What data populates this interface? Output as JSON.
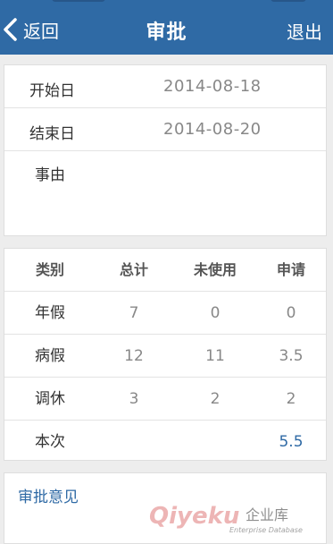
{
  "nav": {
    "back_label": "返回",
    "title": "审批",
    "exit_label": "退出"
  },
  "request": {
    "start_label": "开始日",
    "start_value": "2014-08-18",
    "end_label": "结束日",
    "end_value": "2014-08-20",
    "reason_label": "事由"
  },
  "leave_table": {
    "headers": [
      "类别",
      "总计",
      "未使用",
      "申请"
    ],
    "rows": [
      [
        "年假",
        "7",
        "0",
        "0"
      ],
      [
        "病假",
        "12",
        "11",
        "3.5"
      ],
      [
        "调休",
        "3",
        "2",
        "2"
      ],
      [
        "本次",
        "",
        "",
        "5.5"
      ]
    ]
  },
  "opinion": {
    "label": "审批意见"
  },
  "watermark": {
    "brand": "Qiyeku",
    "cn": "企业库",
    "sub": "Enterprise Database"
  },
  "colors": {
    "accent": "#2f6aa5",
    "background": "#ededed"
  }
}
